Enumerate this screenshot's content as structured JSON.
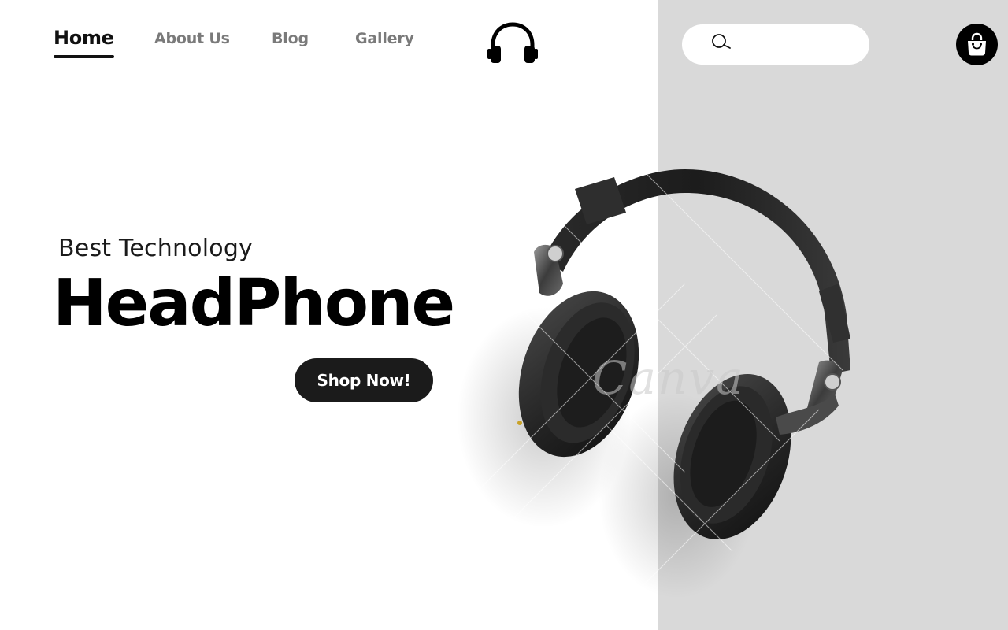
{
  "nav": {
    "items": [
      {
        "label": "Home",
        "active": true
      },
      {
        "label": "About Us",
        "active": false
      },
      {
        "label": "Blog",
        "active": false
      },
      {
        "label": "Gallery",
        "active": false
      }
    ]
  },
  "logo": {
    "icon": "headphones-icon"
  },
  "search": {
    "placeholder": "",
    "icon": "search-icon"
  },
  "cart": {
    "icon": "shopping-bag-icon"
  },
  "hero": {
    "eyebrow": "Best Technology",
    "headline": "HeadPhone",
    "cta_label": "Shop Now!"
  },
  "product_image": {
    "alt": "Black over-ear headphones",
    "watermark": "Canva"
  },
  "colors": {
    "background": "#ffffff",
    "panel": "#d9d9d9",
    "text_primary": "#000000",
    "nav_inactive": "#7a7a7a",
    "button": "#1b1b1b"
  }
}
